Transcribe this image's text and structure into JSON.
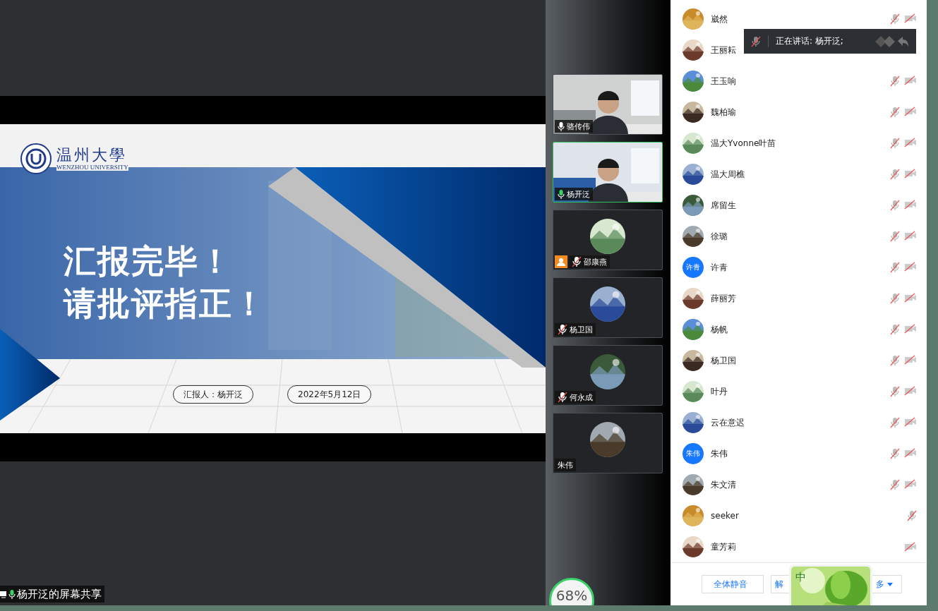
{
  "slide": {
    "logo_name": "温州大學",
    "logo_subtitle": "WENZHOU UNIVERSITY",
    "title_lines": [
      "汇报完毕！",
      "请批评指正！"
    ],
    "pills": [
      "汇报人：杨开泛",
      "2022年5月12日"
    ]
  },
  "share_label": {
    "text": "杨开泛的屏幕共享"
  },
  "video_tiles": [
    {
      "name": "骆传伟",
      "kind": "video",
      "mic_on": true,
      "mic_muted": false,
      "selected": false,
      "host_badge": false
    },
    {
      "name": "杨开泛",
      "kind": "video",
      "mic_on": true,
      "mic_muted": false,
      "selected": true,
      "host_badge": false
    },
    {
      "name": "邵康燕",
      "kind": "avatar",
      "mic_on": false,
      "mic_muted": true,
      "selected": false,
      "host_badge": true
    },
    {
      "name": "杨卫国",
      "kind": "avatar",
      "mic_on": false,
      "mic_muted": true,
      "selected": false,
      "host_badge": false
    },
    {
      "name": "何永成",
      "kind": "avatar",
      "mic_on": false,
      "mic_muted": true,
      "selected": false,
      "host_badge": false
    },
    {
      "name": "朱伟",
      "kind": "avatar",
      "mic_on": false,
      "mic_muted": false,
      "selected": false,
      "host_badge": false
    }
  ],
  "network": {
    "percent": "68%"
  },
  "participants": [
    {
      "name": "崴然",
      "mic_off": true,
      "camera_off": true
    },
    {
      "name": "王丽耘"
    },
    {
      "name": "王玉响",
      "mic_off": true,
      "camera_off": true
    },
    {
      "name": "魏柏瑜",
      "mic_off": true,
      "camera_off": true
    },
    {
      "name": "温大Yvonne叶苗",
      "mic_off": true,
      "camera_off": true
    },
    {
      "name": "温大周樵",
      "mic_off": true,
      "camera_off": true
    },
    {
      "name": "席留生",
      "mic_off": true,
      "camera_off": true
    },
    {
      "name": "徐璐",
      "mic_off": true,
      "camera_off": true
    },
    {
      "name": "许青",
      "avatar": {
        "kind": "initials",
        "text": "许青"
      },
      "mic_off": true,
      "camera_off": true
    },
    {
      "name": "薛丽芳",
      "mic_off": true,
      "camera_off": true
    },
    {
      "name": "杨帆",
      "mic_off": true,
      "camera_off": true
    },
    {
      "name": "杨卫国",
      "mic_off": true,
      "camera_off": true
    },
    {
      "name": "叶丹",
      "mic_off": true,
      "camera_off": true
    },
    {
      "name": "云在意迟",
      "mic_off": true,
      "camera_off": true
    },
    {
      "name": "朱伟",
      "avatar": {
        "kind": "initials",
        "text": "朱伟"
      },
      "mic_off": true,
      "camera_off": true
    },
    {
      "name": "朱文清",
      "mic_off": true,
      "camera_off": true
    },
    {
      "name": "seeker",
      "mic_off": true,
      "camera_off": false
    },
    {
      "name": "童芳莉",
      "mic_off": false,
      "camera_off": true
    }
  ],
  "speaking_banner": {
    "text": "正在讲话: 杨开泛;"
  },
  "footer_buttons": [
    "全体静音",
    "解",
    "多"
  ],
  "ime": {
    "mode": "中"
  }
}
